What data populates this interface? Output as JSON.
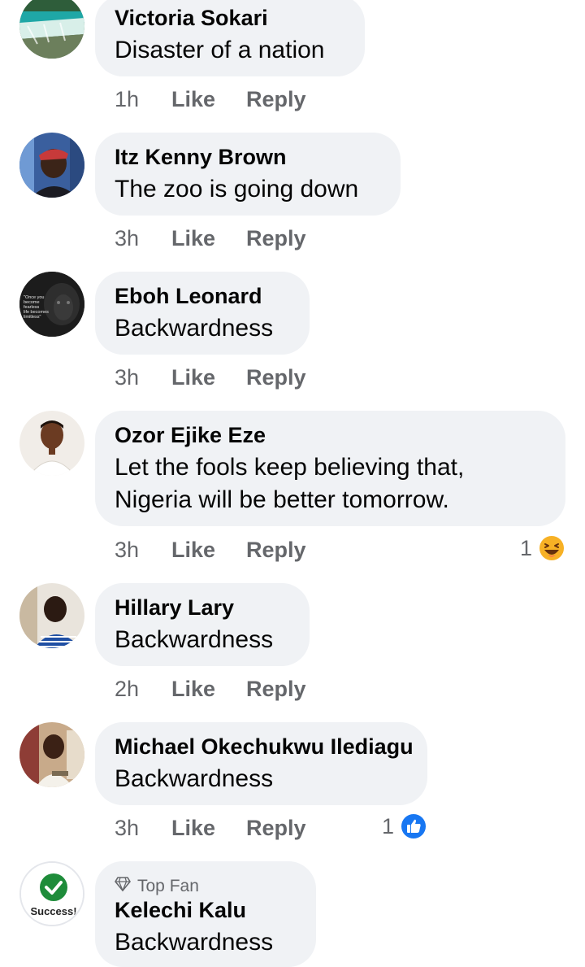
{
  "comments": [
    {
      "author": "Victoria Sokari",
      "text": "Disaster of a nation",
      "time": "1h",
      "like": "Like",
      "reply": "Reply"
    },
    {
      "author": "Itz Kenny Brown",
      "text": "The zoo is going down",
      "time": "3h",
      "like": "Like",
      "reply": "Reply"
    },
    {
      "author": "Eboh Leonard",
      "text": "Backwardness",
      "time": "3h",
      "like": "Like",
      "reply": "Reply",
      "avatar_text": "\"Once you become fearless life becomes limitless\""
    },
    {
      "author": "Ozor Ejike Eze",
      "text_line1": "Let the fools keep believing that,",
      "text_line2": "Nigeria will be better tomorrow.",
      "time": "3h",
      "like": "Like",
      "reply": "Reply",
      "reaction_count": "1",
      "reaction_icon": "laugh-reaction-icon"
    },
    {
      "author": "Hillary Lary",
      "text": "Backwardness",
      "time": "2h",
      "like": "Like",
      "reply": "Reply"
    },
    {
      "author": "Michael Okechukwu Ilediagu",
      "text": "Backwardness",
      "time": "3h",
      "like": "Like",
      "reply": "Reply",
      "reaction_count": "1",
      "reaction_icon": "like-reaction-icon"
    },
    {
      "badge": "Top Fan",
      "badge_icon": "diamond-icon",
      "author": "Kelechi Kalu",
      "text": "Backwardness",
      "avatar_text": "Success!"
    }
  ],
  "colors": {
    "bubble": "#f0f2f5",
    "text": "#050505",
    "meta": "#65676b",
    "like_blue": "#1877f2",
    "laugh_yellow": "#f7b125",
    "success_green": "#1e8c3a"
  }
}
